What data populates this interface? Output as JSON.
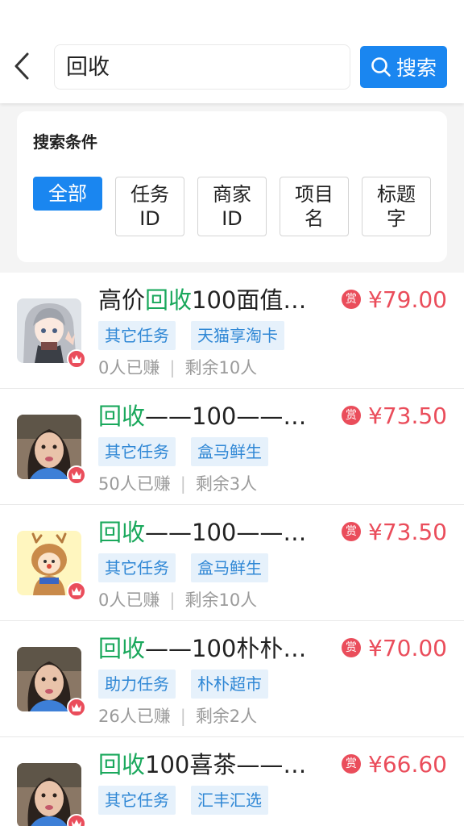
{
  "search": {
    "value": "回收",
    "button_label": "搜索"
  },
  "filter": {
    "title": "搜索条件",
    "chips": [
      "全部",
      "任务ID",
      "商家ID",
      "项目名",
      "标题字"
    ]
  },
  "reward_badge": "赏",
  "colors": {
    "accent": "#1a86f0",
    "price": "#ea4d5b",
    "highlight": "#1aa85c",
    "tag_bg": "#e6f1fb",
    "tag_text": "#2f87d5"
  },
  "items": [
    {
      "title_prefix": "高价",
      "title_highlight": "回收",
      "title_suffix": "100面值…",
      "price": "¥79.00",
      "tags": [
        "其它任务",
        "天猫享淘卡"
      ],
      "earned": "0人已赚",
      "remaining": "剩余10人",
      "avatar": "anime-girl-avatar"
    },
    {
      "title_prefix": "",
      "title_highlight": "回收",
      "title_suffix": "——100——…",
      "price": "¥73.50",
      "tags": [
        "其它任务",
        "盒马鲜生"
      ],
      "earned": "50人已赚",
      "remaining": "剩余3人",
      "avatar": "girl-photo-avatar"
    },
    {
      "title_prefix": "",
      "title_highlight": "回收",
      "title_suffix": "——100——…",
      "price": "¥73.50",
      "tags": [
        "其它任务",
        "盒马鲜生"
      ],
      "earned": "0人已赚",
      "remaining": "剩余10人",
      "avatar": "deer-cartoon-avatar"
    },
    {
      "title_prefix": "",
      "title_highlight": "回收",
      "title_suffix": "——100朴朴…",
      "price": "¥70.00",
      "tags": [
        "助力任务",
        "朴朴超市"
      ],
      "earned": "26人已赚",
      "remaining": "剩余2人",
      "avatar": "girl-photo-avatar"
    },
    {
      "title_prefix": "",
      "title_highlight": "回收",
      "title_suffix": "100喜茶——1…",
      "price": "¥66.60",
      "tags": [
        "其它任务",
        "汇丰汇选"
      ],
      "earned": "",
      "remaining": "",
      "avatar": "girl-photo-avatar"
    }
  ]
}
